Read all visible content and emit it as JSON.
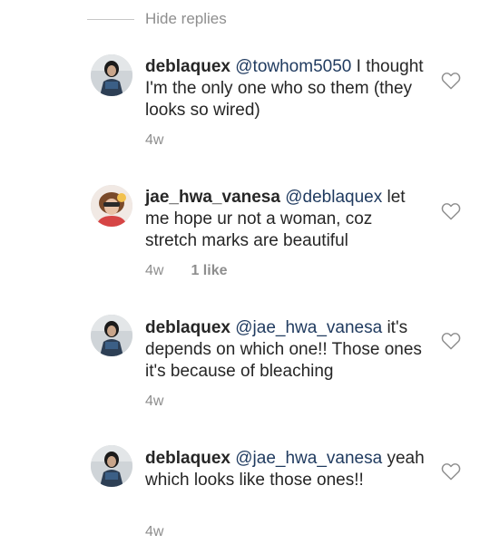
{
  "replies_toggle": {
    "label": "Hide replies"
  },
  "comments": [
    {
      "username": "deblaquex",
      "mention": "@towhom5050",
      "text": " I thought I'm the only one who so them (they looks so wired)",
      "time": "4w",
      "likes": ""
    },
    {
      "username": "jae_hwa_vanesa",
      "mention": "@deblaquex",
      "text": " let me hope ur not a woman, coz stretch marks are beautiful",
      "time": "4w",
      "likes": "1 like"
    },
    {
      "username": "deblaquex",
      "mention": "@jae_hwa_vanesa",
      "text": " it's depends on which one!! Those ones it's because of bleaching",
      "time": "4w",
      "likes": ""
    },
    {
      "username": "deblaquex",
      "mention": "@jae_hwa_vanesa",
      "text": " yeah which looks like those ones!!",
      "time": "4w",
      "likes": ""
    }
  ],
  "icons": {
    "like": "heart-outline-icon",
    "avatar_deblaquex": "profile-photo",
    "avatar_jae": "profile-photo"
  },
  "colors": {
    "text": "#262626",
    "secondary": "#8e8e8e",
    "mention": "#1f3a5f",
    "divider": "#c7c7c7"
  }
}
